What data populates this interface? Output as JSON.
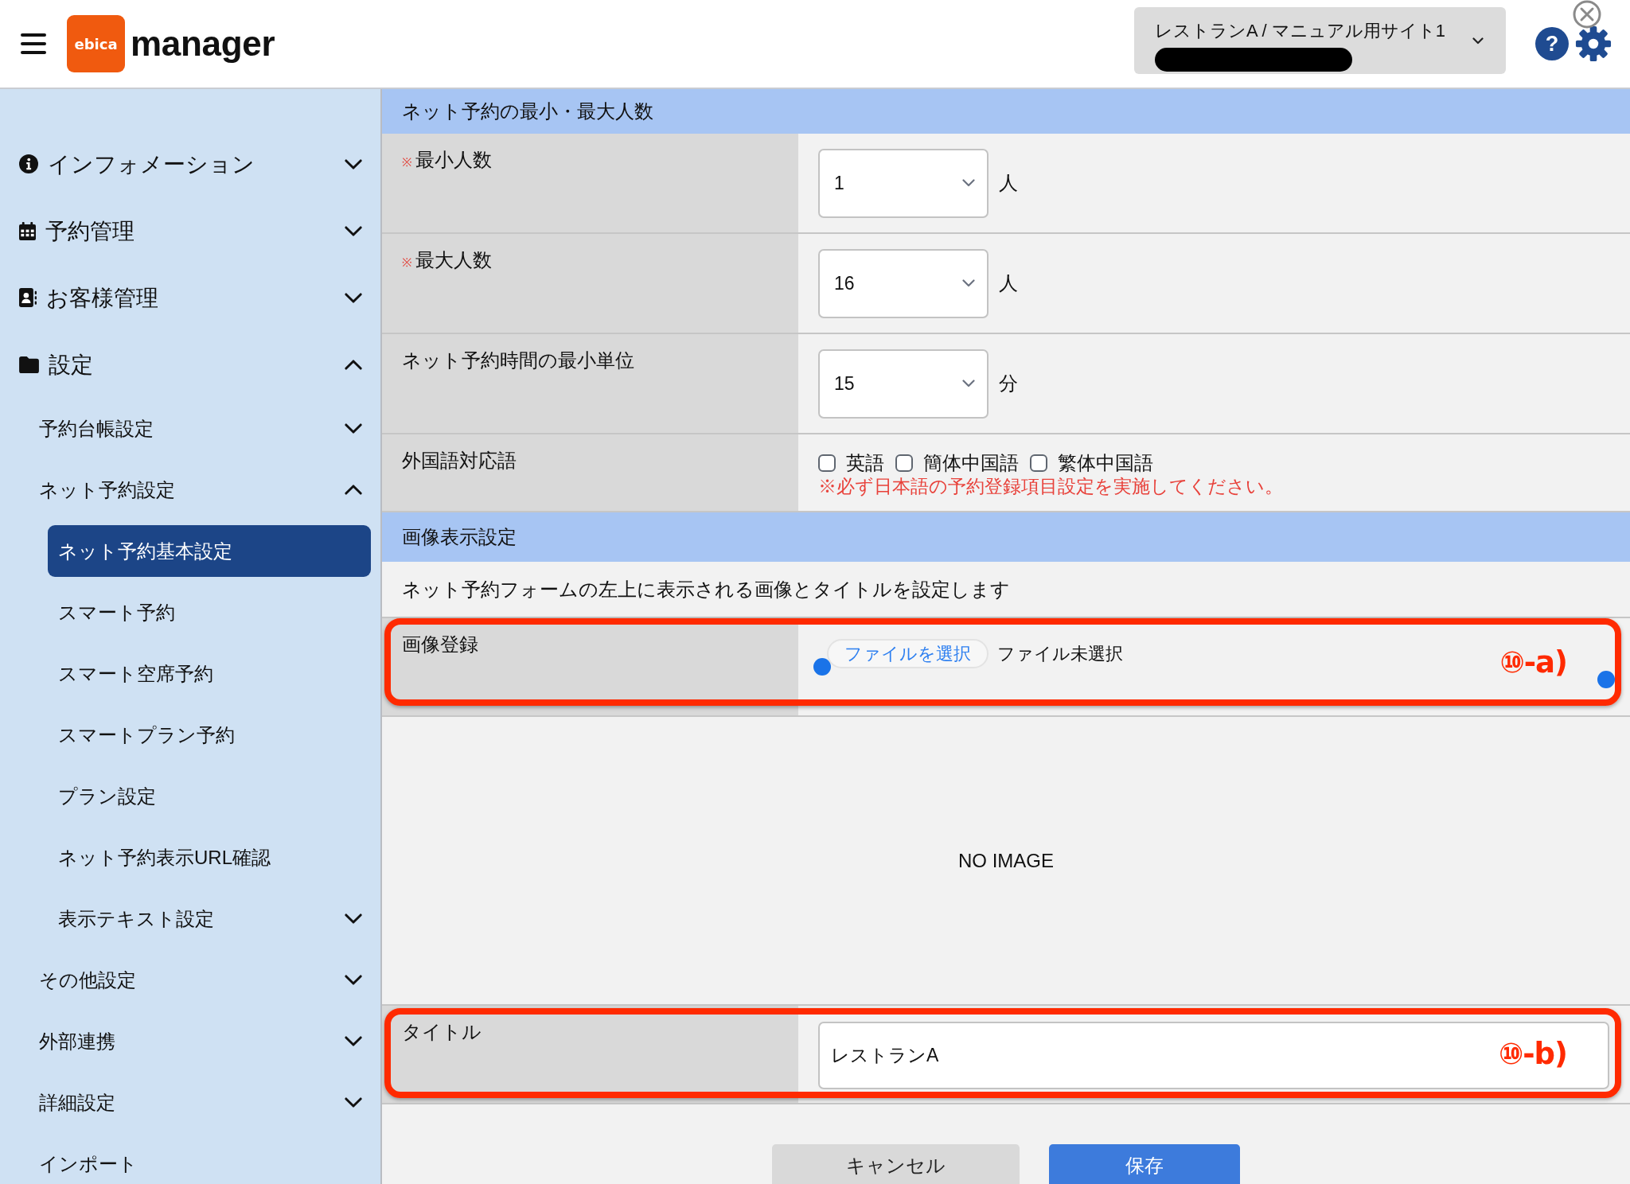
{
  "header": {
    "logo": {
      "badge": "ebica",
      "name": "manager"
    },
    "site_selector": {
      "label": "レストランA / マニュアル用サイト1",
      "redacted": true
    },
    "help_button": "?"
  },
  "sidebar": {
    "items": [
      {
        "label": "インフォメーション",
        "expanded": false,
        "selected": false
      },
      {
        "label": "予約管理",
        "expanded": false,
        "selected": false
      },
      {
        "label": "お客様管理",
        "expanded": false,
        "selected": false
      },
      {
        "label": "設定",
        "expanded": true,
        "selected": false,
        "children": [
          {
            "label": "予約台帳設定",
            "expanded": false,
            "selected": false
          },
          {
            "label": "ネット予約設定",
            "expanded": true,
            "selected": false,
            "children": [
              {
                "label": "ネット予約基本設定",
                "selected": true
              },
              {
                "label": "スマート予約",
                "selected": false
              },
              {
                "label": "スマート空席予約",
                "selected": false
              },
              {
                "label": "スマートプラン予約",
                "selected": false
              },
              {
                "label": "プラン設定",
                "selected": false
              },
              {
                "label": "ネット予約表示URL確認",
                "selected": false
              },
              {
                "label": "表示テキスト設定",
                "expanded": false,
                "selected": false
              }
            ]
          },
          {
            "label": "その他設定",
            "expanded": false,
            "selected": false
          },
          {
            "label": "外部連携",
            "expanded": false,
            "selected": false
          },
          {
            "label": "詳細設定",
            "expanded": false,
            "selected": false
          },
          {
            "label": "インポート",
            "selected": false
          }
        ]
      }
    ]
  },
  "sections": [
    {
      "title": "ネット予約の最小・最大人数",
      "rows": [
        {
          "kind": "select",
          "required_mark": "※",
          "label": "最小人数",
          "value": "1",
          "unit": "人"
        },
        {
          "kind": "select",
          "required_mark": "※",
          "label": "最大人数",
          "value": "16",
          "unit": "人"
        },
        {
          "kind": "select",
          "label": "ネット予約時間の最小単位",
          "value": "15",
          "unit": "分"
        },
        {
          "kind": "checkboxes",
          "label": "外国語対応語",
          "options": [
            {
              "label": "英語",
              "checked": false
            },
            {
              "label": "簡体中国語",
              "checked": false
            },
            {
              "label": "繁体中国語",
              "checked": false
            }
          ],
          "note": "※必ず日本語の予約登録項目設定を実施してください。"
        }
      ]
    },
    {
      "title": "画像表示設定",
      "rows": [
        {
          "kind": "description",
          "text": "ネット予約フォームの左上に表示される画像とタイトルを設定します"
        },
        {
          "kind": "file",
          "label": "画像登録",
          "button": "ファイルを選択",
          "status": "ファイル未選択",
          "annotation": {
            "label": "⑩-a)",
            "handles": true
          }
        },
        {
          "kind": "image",
          "text": "NO IMAGE"
        },
        {
          "kind": "text",
          "label": "タイトル",
          "value": "レストランA",
          "annotation": {
            "label": "⑩-b)"
          }
        }
      ]
    }
  ],
  "buttons": [
    {
      "kind": "cancel",
      "label": "キャンセル"
    },
    {
      "kind": "save",
      "label": "保存"
    }
  ]
}
